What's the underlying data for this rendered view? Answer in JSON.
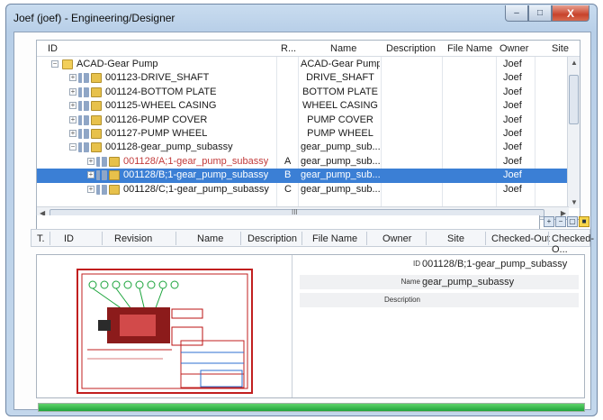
{
  "window": {
    "title": "Joef (joef) - Engineering/Designer",
    "min": "‒",
    "max": "□",
    "close": "X"
  },
  "tree": {
    "columns": [
      "ID",
      "R...",
      "Name",
      "Description",
      "File Name",
      "Owner",
      "Site"
    ],
    "rows": [
      {
        "id": "ACAD-Gear Pump",
        "rev": "",
        "name": "ACAD-Gear Pump",
        "owner": "Joef",
        "indent": 0,
        "icon": "folder-icon",
        "exp": "−"
      },
      {
        "id": "001123-DRIVE_SHAFT",
        "rev": "",
        "name": "DRIVE_SHAFT",
        "owner": "Joef",
        "indent": 1,
        "icon": "item-icon",
        "exp": "+"
      },
      {
        "id": "001124-BOTTOM PLATE",
        "rev": "",
        "name": "BOTTOM PLATE",
        "owner": "Joef",
        "indent": 1,
        "icon": "item-icon",
        "exp": "+"
      },
      {
        "id": "001125-WHEEL CASING",
        "rev": "",
        "name": "WHEEL CASING",
        "owner": "Joef",
        "indent": 1,
        "icon": "item-icon",
        "exp": "+"
      },
      {
        "id": "001126-PUMP COVER",
        "rev": "",
        "name": "PUMP COVER",
        "owner": "Joef",
        "indent": 1,
        "icon": "item-icon",
        "exp": "+"
      },
      {
        "id": "001127-PUMP WHEEL",
        "rev": "",
        "name": "PUMP WHEEL",
        "owner": "Joef",
        "indent": 1,
        "icon": "item-icon",
        "exp": "+"
      },
      {
        "id": "001128-gear_pump_subassy",
        "rev": "",
        "name": "gear_pump_sub...",
        "owner": "Joef",
        "indent": 1,
        "icon": "item-icon",
        "exp": "−"
      },
      {
        "id": "001128/A;1-gear_pump_subassy",
        "rev": "A",
        "name": "gear_pump_sub...",
        "owner": "Joef",
        "indent": 2,
        "icon": "revision-icon",
        "exp": "+",
        "red": true
      },
      {
        "id": "001128/B;1-gear_pump_subassy",
        "rev": "B",
        "name": "gear_pump_sub...",
        "owner": "Joef",
        "indent": 2,
        "icon": "revision-icon",
        "exp": "+",
        "red": true,
        "selected": true
      },
      {
        "id": "001128/C;1-gear_pump_subassy",
        "rev": "C",
        "name": "gear_pump_sub...",
        "owner": "Joef",
        "indent": 2,
        "icon": "revision-icon",
        "exp": "+"
      }
    ],
    "hscroll_mark": "III"
  },
  "filter": {
    "value": ""
  },
  "columns": [
    "T.",
    "ID",
    "Revision",
    "Name",
    "Description",
    "File Name",
    "Owner",
    "Site",
    "Checked-Out",
    "Checked-O..."
  ],
  "preview": {
    "props": [
      {
        "label": "ID",
        "value": "001128/B;1-gear_pump_subassy"
      },
      {
        "label": "Name",
        "value": "gear_pump_subassy"
      },
      {
        "label": "Description",
        "value": ""
      }
    ]
  },
  "progress": {
    "fraction": 1.0
  },
  "colors": {
    "selection": "#3b7fd5",
    "progress": "#1fa33a",
    "red_text": "#c23a3a"
  }
}
